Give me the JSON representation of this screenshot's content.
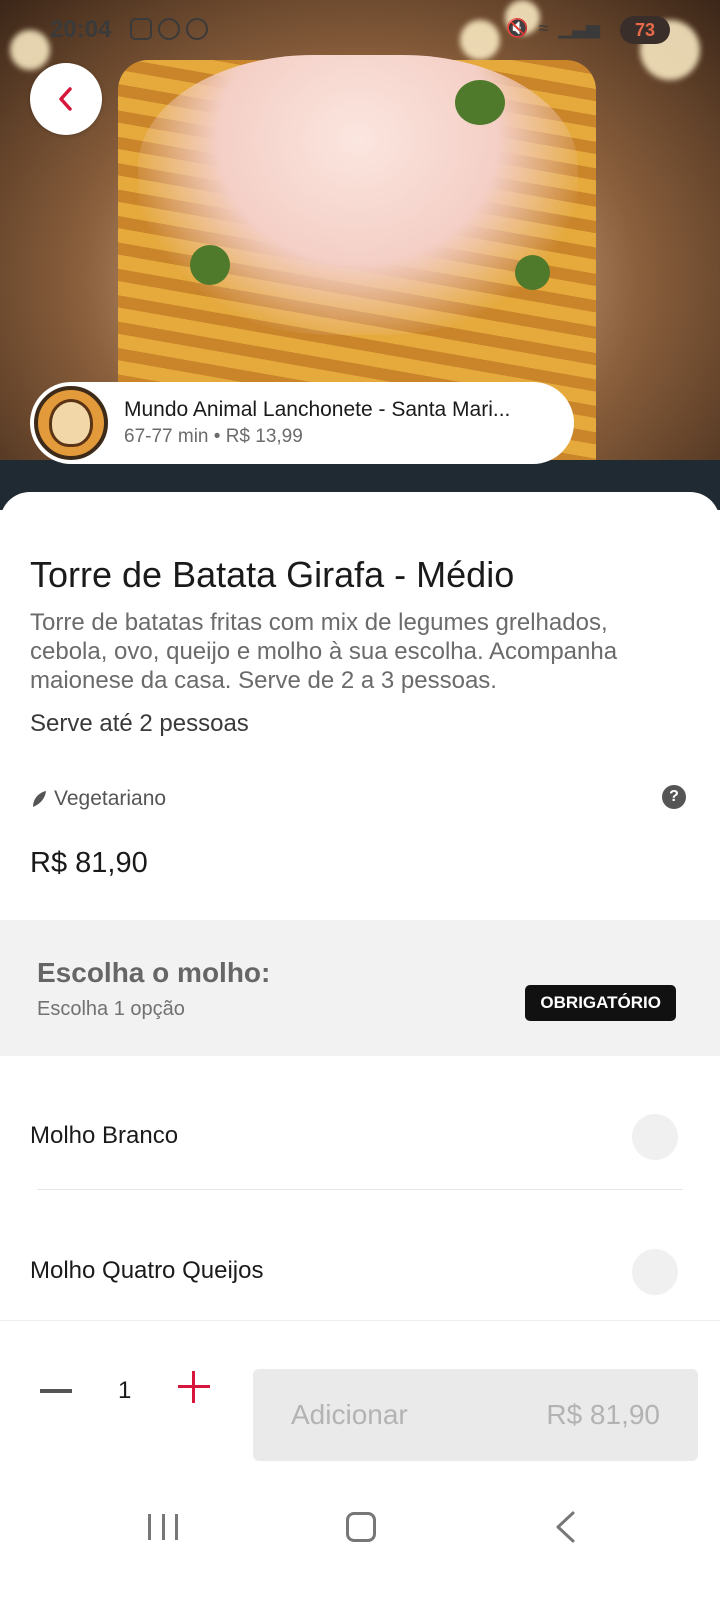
{
  "status_bar": {
    "time": "20:04",
    "battery": "73"
  },
  "store": {
    "name": "Mundo Animal Lanchonete - Santa Mari...",
    "meta": "67-77 min • R$ 13,99"
  },
  "product": {
    "title": "Torre de Batata Girafa - Médio",
    "description": "Torre de batatas fritas com mix de legumes grelhados, cebola, ovo, queijo e molho à sua escolha. Acompanha maionese da casa. Serve de 2 a 3 pessoas.",
    "serves": "Serve até 2 pessoas",
    "tag": "Vegetariano",
    "price": "R$ 81,90"
  },
  "options_section": {
    "title": "Escolha o molho:",
    "subtitle": "Escolha 1 opção",
    "badge": "OBRIGATÓRIO",
    "options": [
      {
        "label": "Molho Branco"
      },
      {
        "label": "Molho Quatro Queijos"
      }
    ]
  },
  "footer": {
    "quantity": "1",
    "add_label": "Adicionar",
    "add_price": "R$ 81,90"
  },
  "colors": {
    "accent": "#d6163b",
    "badge_bg": "#111111",
    "disabled_button": "#eaeaea"
  },
  "icons": {
    "back": "chevron-left-icon",
    "veg": "leaf-icon",
    "help": "question-icon",
    "minus": "minus-icon",
    "plus": "plus-icon"
  }
}
